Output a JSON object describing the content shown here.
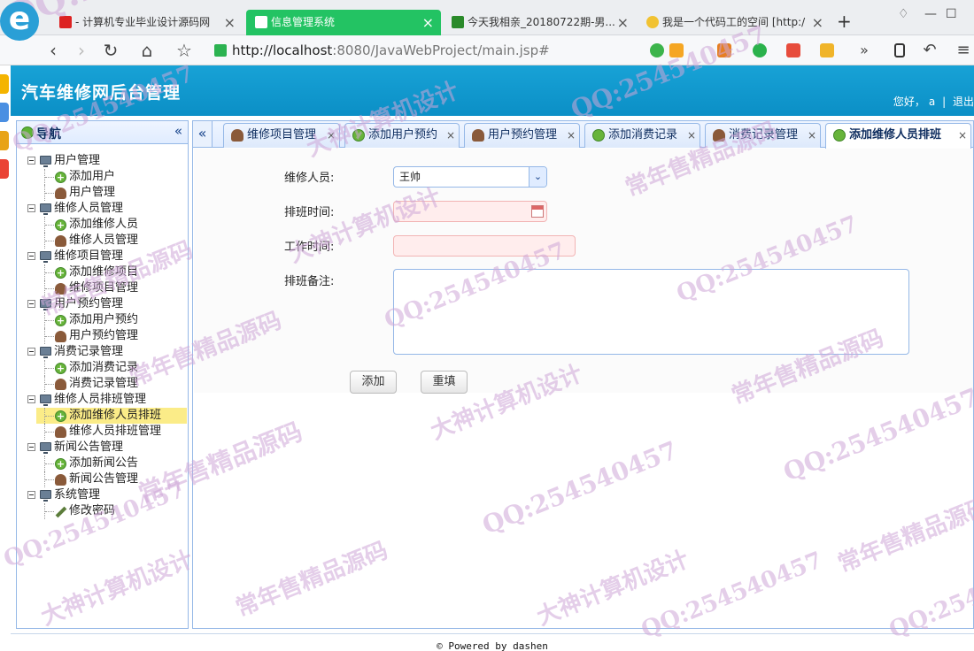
{
  "browser": {
    "tabs": [
      {
        "label": "- 计算机专业毕业设计源码网",
        "active": false
      },
      {
        "label": "信息管理系统",
        "active": true
      },
      {
        "label": "今天我相亲_20180722期-男...",
        "active": false
      },
      {
        "label": "我是一个代码工的空间 [http:/",
        "active": false
      }
    ],
    "new_tab": "+",
    "url_host": "http://localhost",
    "url_rest": ":8080/JavaWebProject/main.jsp#"
  },
  "app": {
    "title": "汽车维修网后台管理",
    "greeting": "您好，",
    "username": "a",
    "separator": "|",
    "logout": "退出"
  },
  "nav": {
    "title": "导航",
    "collapse": "«",
    "tree": [
      {
        "label": "用户管理",
        "type": "group"
      },
      {
        "label": "添加用户",
        "type": "add"
      },
      {
        "label": "用户管理",
        "type": "user"
      },
      {
        "label": "维修人员管理",
        "type": "group"
      },
      {
        "label": "添加维修人员",
        "type": "add"
      },
      {
        "label": "维修人员管理",
        "type": "user"
      },
      {
        "label": "维修项目管理",
        "type": "group"
      },
      {
        "label": "添加维修项目",
        "type": "add"
      },
      {
        "label": "维修项目管理",
        "type": "user"
      },
      {
        "label": "用户预约管理",
        "type": "group"
      },
      {
        "label": "添加用户预约",
        "type": "add"
      },
      {
        "label": "用户预约管理",
        "type": "user"
      },
      {
        "label": "消费记录管理",
        "type": "group"
      },
      {
        "label": "添加消费记录",
        "type": "add"
      },
      {
        "label": "消费记录管理",
        "type": "user"
      },
      {
        "label": "维修人员排班管理",
        "type": "group"
      },
      {
        "label": "添加维修人员排班",
        "type": "add",
        "selected": true
      },
      {
        "label": "维修人员排班管理",
        "type": "user"
      },
      {
        "label": "新闻公告管理",
        "type": "group"
      },
      {
        "label": "添加新闻公告",
        "type": "add"
      },
      {
        "label": "新闻公告管理",
        "type": "user"
      },
      {
        "label": "系统管理",
        "type": "group"
      },
      {
        "label": "修改密码",
        "type": "pen"
      }
    ]
  },
  "tabs": {
    "scroll_left": "«",
    "items": [
      {
        "label": "维修项目管理",
        "icon": "user"
      },
      {
        "label": "添加用户预约",
        "icon": "add"
      },
      {
        "label": "用户预约管理",
        "icon": "user"
      },
      {
        "label": "添加消费记录",
        "icon": "add"
      },
      {
        "label": "消费记录管理",
        "icon": "user"
      },
      {
        "label": "添加维修人员排班",
        "icon": "add",
        "active": true
      }
    ],
    "close": "×"
  },
  "form": {
    "staff_label": "维修人员:",
    "staff_value": "王帅",
    "date_label": "排班时间:",
    "date_value": "",
    "worktime_label": "工作时间:",
    "worktime_value": "",
    "note_label": "排班备注:",
    "note_value": "",
    "add_button": "添加",
    "reset_button": "重填"
  },
  "footer": {
    "text": "© Powered by dashen"
  },
  "watermarks": [
    "QQ:254540457",
    "常年售精品源码",
    "大神计算机设计"
  ],
  "colors": {
    "header": "#0b8fc6",
    "active_browser_tab": "#23c363",
    "panel_border": "#95b8e7",
    "selection": "#fbec88"
  }
}
